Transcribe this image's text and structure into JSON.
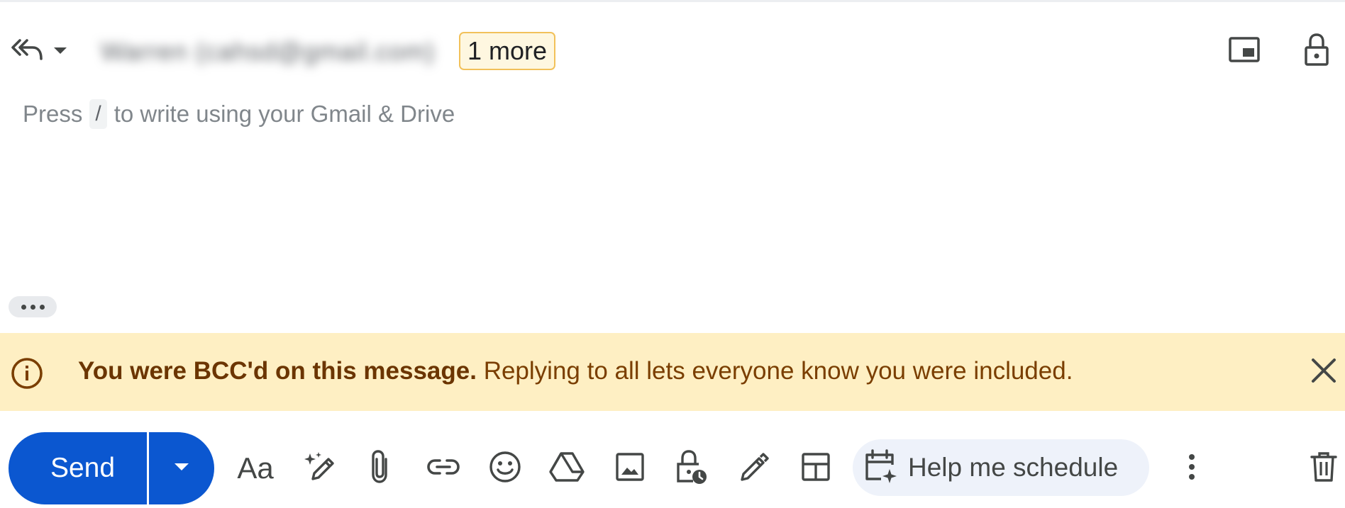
{
  "header": {
    "recipient_blurred": "Warren (cahsd@gmail.com)",
    "more_chip": "1 more"
  },
  "body": {
    "hint_before": "Press",
    "hint_key": "/",
    "hint_after": "to write using your Gmail & Drive"
  },
  "banner": {
    "bold_text": "You were BCC'd on this message.",
    "text": " Replying to all lets everyone know you were included.",
    "background": "#feefc3"
  },
  "toolbar": {
    "send_label": "Send",
    "format_label": "Aa",
    "schedule_label": "Help me schedule",
    "accent": "#0b57d0",
    "icons": [
      "reply-all-icon",
      "chevron-down-icon",
      "pop-out-icon",
      "lock-icon",
      "formatting-icon",
      "sparkle-pen-icon",
      "attach-icon",
      "link-icon",
      "emoji-icon",
      "drive-icon",
      "image-icon",
      "confidential-mode-icon",
      "signature-icon",
      "layout-icon",
      "calendar-sparkle-icon",
      "more-vert-icon",
      "trash-icon"
    ]
  }
}
